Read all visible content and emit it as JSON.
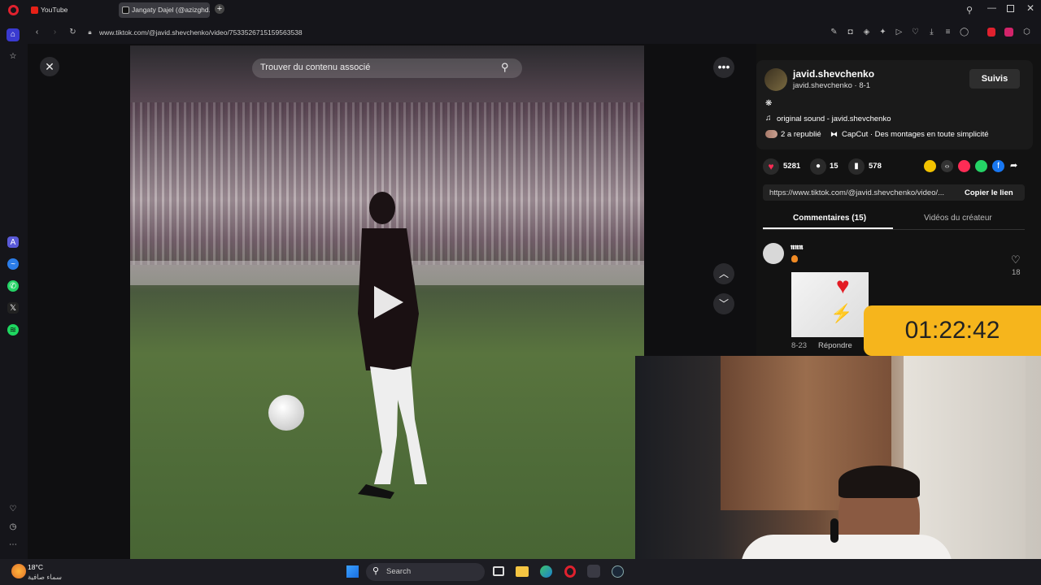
{
  "browser": {
    "tabs": [
      {
        "label": "YouTube",
        "active": false
      },
      {
        "label": "Jangaty Dajel (@azizghd...",
        "active": true
      }
    ],
    "url": "www.tiktok.com/@javid.shevchenko/video/7533526715159563538"
  },
  "video": {
    "search_placeholder": "Trouver du contenu associé"
  },
  "panel": {
    "username": "javid.shevchenko",
    "handle_line": "javid.shevchenko · 8-1",
    "follow_button": "Suivis",
    "caption": "❋",
    "sound": "original sound - javid.shevchenko",
    "reposted": "2 a republié",
    "capcut": "CapCut · Des montages en toute simplicité",
    "likes": "5281",
    "comments": "15",
    "saves": "578",
    "link": "https://www.tiktok.com/@javid.shevchenko/video/...",
    "copy_link": "Copier le lien",
    "tab_comments": "Commentaires (15)",
    "tab_creator": "Vidéos du créateur",
    "comment": {
      "author": "𝖓𝖓𝖓",
      "date": "8-23",
      "reply": "Répondre",
      "like_count": "18"
    }
  },
  "overlay": {
    "timer": "01:22:42"
  },
  "taskbar": {
    "weather_temp": "18°C",
    "weather_desc": "سماء صافية",
    "search": "Search"
  },
  "colors": {
    "accent_pink": "#fe2c55",
    "timer_bg": "#f6b51c"
  }
}
